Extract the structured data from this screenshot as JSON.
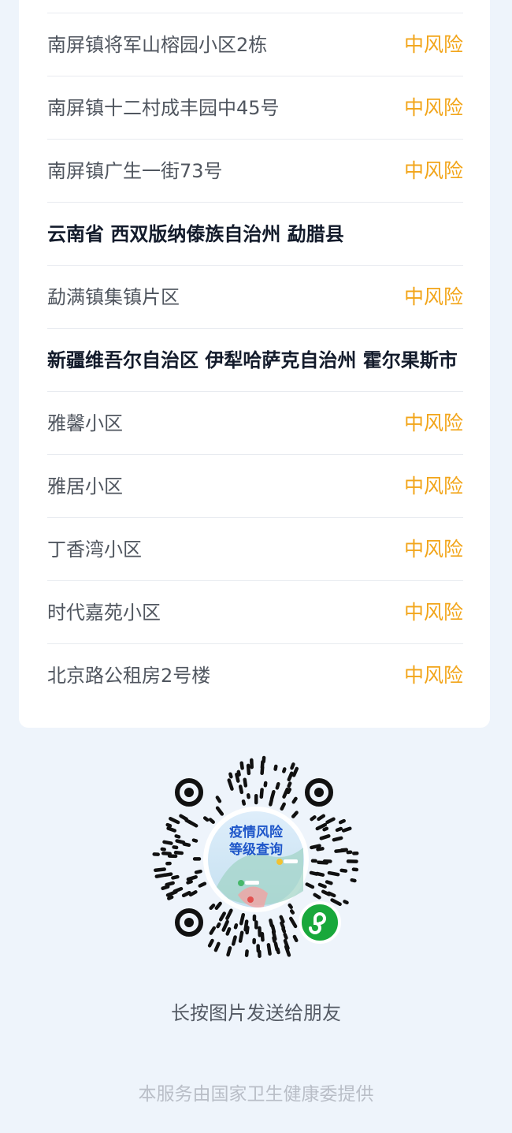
{
  "list": {
    "rows": [
      {
        "type": "place",
        "name": "南屏镇将军山榕园小区2栋",
        "risk": "中风险"
      },
      {
        "type": "place",
        "name": "南屏镇十二村成丰园中45号",
        "risk": "中风险"
      },
      {
        "type": "place",
        "name": "南屏镇广生一街73号",
        "risk": "中风险"
      },
      {
        "type": "region",
        "name": "云南省 西双版纳傣族自治州 勐腊县"
      },
      {
        "type": "place",
        "name": "勐满镇集镇片区",
        "risk": "中风险"
      },
      {
        "type": "region",
        "name": "新疆维吾尔自治区 伊犁哈萨克自治州 霍尔果斯市"
      },
      {
        "type": "place",
        "name": "雅馨小区",
        "risk": "中风险"
      },
      {
        "type": "place",
        "name": "雅居小区",
        "risk": "中风险"
      },
      {
        "type": "place",
        "name": "丁香湾小区",
        "risk": "中风险"
      },
      {
        "type": "place",
        "name": "时代嘉苑小区",
        "risk": "中风险"
      },
      {
        "type": "place",
        "name": "北京路公租房2号楼",
        "risk": "中风险"
      }
    ]
  },
  "qr": {
    "title_line1": "疫情风险",
    "title_line2": "等级查询",
    "icon": "mini-program-icon"
  },
  "footer": {
    "share_hint": "长按图片发送给朋友",
    "provider": "本服务由国家卫生健康委提供"
  },
  "colors": {
    "risk_medium": "#f2a51a",
    "mini_program_green": "#19a83b",
    "region_text": "#131b2b"
  }
}
